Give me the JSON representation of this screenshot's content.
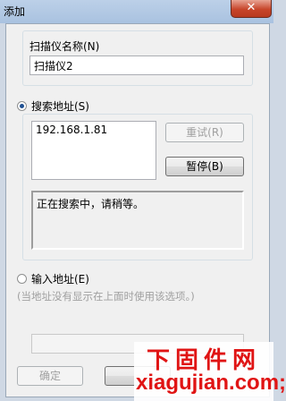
{
  "window": {
    "title": "添加",
    "close_glyph": "✕"
  },
  "scanner_name": {
    "label": "扫描仪名称(N)",
    "value": "扫描仪2"
  },
  "search_address": {
    "label": "搜索地址(S)",
    "selected": true,
    "results": [
      "192.168.1.81"
    ],
    "retry_label": "重试(R)",
    "pause_label": "暂停(B)",
    "status": "正在搜索中，请稍等。"
  },
  "input_address": {
    "label": "输入地址(E)",
    "selected": false,
    "hint": "(当地址没有显示在上面时使用该选项。)",
    "value": ""
  },
  "footer": {
    "ok_label": "确定"
  },
  "watermark": {
    "line1": "下固件网",
    "line2": "xiagujian.com;"
  }
}
